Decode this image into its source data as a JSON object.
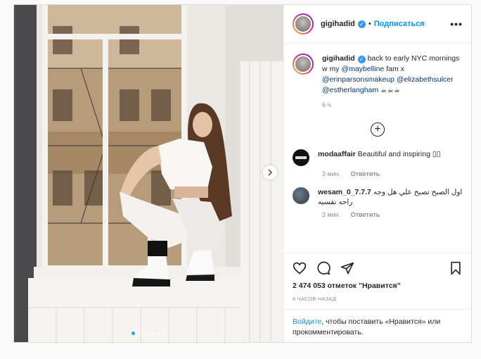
{
  "post": {
    "username": "gigihadid",
    "follow_label": "Подписаться",
    "separator": "•",
    "more_label": "•••",
    "caption": {
      "username": "gigihadid",
      "text_before": "back to early NYC mornings w my ",
      "mention1": "@maybelline",
      "text_mid": " fam x ",
      "mention2": "@erinparsonsmakeup",
      "mention3": "@elizabethsulcer",
      "mention4": "@estherlangham",
      "emoji": "☕☕☕",
      "time": "6 ч."
    },
    "load_more_label": "+",
    "comments": [
      {
        "username": "modaaffair",
        "text": "Beautiful and inspiring ▯▯",
        "time": "3 мин.",
        "reply": "Ответить"
      },
      {
        "username": "wesam_0_7.7.7",
        "text": "اول الصبح تصبح علي هل وجه راحه نفسيه",
        "time": "3 мин.",
        "reply": "Ответить"
      }
    ],
    "likes": "2 474 053 отметок \"Нравится\"",
    "ago": "6 часов назад",
    "login": {
      "link": "Войдите",
      "text": ", чтобы поставить «Нравится» или прокомментировать."
    },
    "carousel": {
      "count": 6,
      "active": 0
    }
  }
}
